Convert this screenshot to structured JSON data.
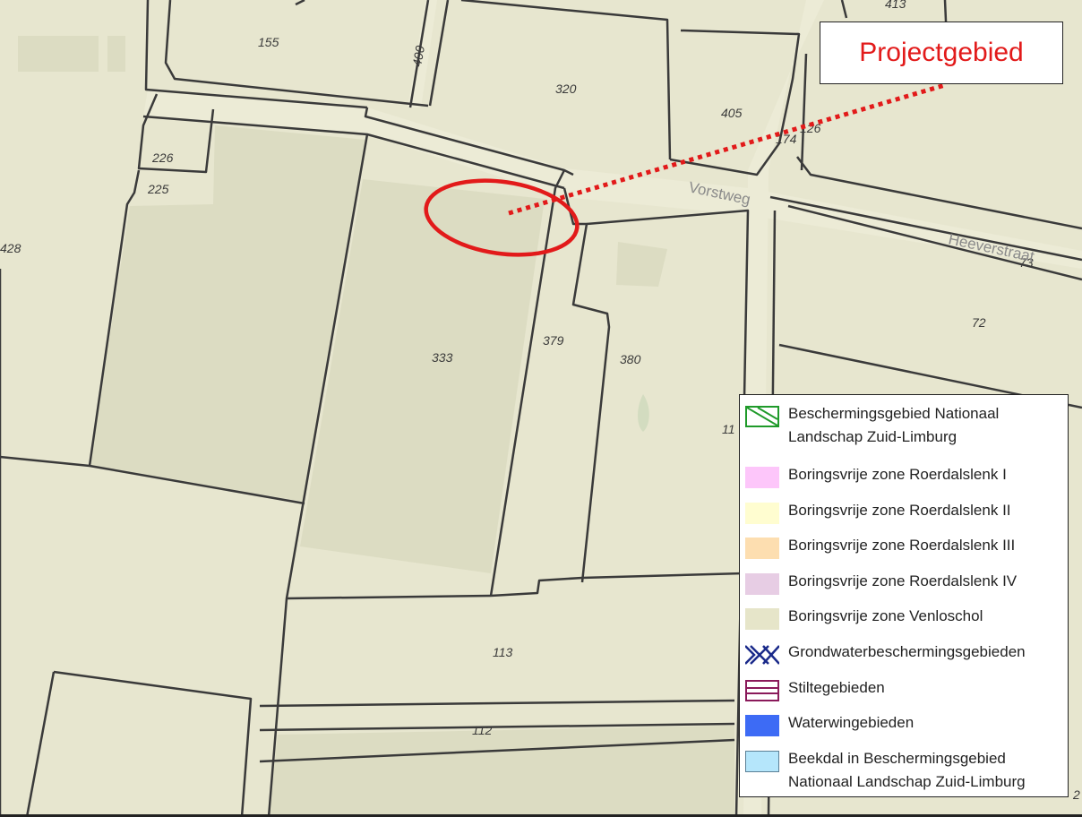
{
  "callout": {
    "label": "Projectgebied",
    "color": "#e21a1a"
  },
  "map": {
    "background_color": "#e7e6cf",
    "parcel_line_color": "#3a3a3a",
    "road_color": "#e7e6cf",
    "shaded_area_color": "#dcdcc2",
    "project_marker_color": "#e21a1a",
    "parcel_labels": [
      "413",
      "155",
      "400",
      "320",
      "405",
      "174",
      "126",
      "226",
      "225",
      "428",
      "333",
      "379",
      "380",
      "72",
      "73",
      "113",
      "112",
      "11",
      "2"
    ],
    "street_labels": [
      "Vorstweg",
      "Heeverstraat"
    ]
  },
  "legend": {
    "items": [
      {
        "label_line1": "Beschermingsgebied Nationaal",
        "label_line2": "Landschap Zuid-Limburg",
        "icon": "hatched-green-square-icon",
        "color": "#1f9a2a"
      },
      {
        "label_line1": "Boringsvrije zone Roerdalslenk I",
        "icon": "pink-swatch",
        "color": "#fdc6fa"
      },
      {
        "label_line1": "Boringsvrije zone Roerdalslenk II",
        "icon": "yellow-swatch",
        "color": "#fffdd0"
      },
      {
        "label_line1": "Boringsvrije zone Roerdalslenk III",
        "icon": "orange-swatch",
        "color": "#fddeb0"
      },
      {
        "label_line1": "Boringsvrije zone Roerdalslenk IV",
        "icon": "purple-swatch",
        "color": "#e7cde4"
      },
      {
        "label_line1": "Boringsvrije zone Venloschol",
        "icon": "beige-swatch",
        "color": "#e6e5c9"
      },
      {
        "label_line1": "Grondwaterbeschermingsgebieden",
        "icon": "blue-cross-hatch-icon",
        "color": "#1a2a8a"
      },
      {
        "label_line1": "Stiltegebieden",
        "icon": "striped-magenta-icon",
        "color": "#8a1a5b"
      },
      {
        "label_line1": "Waterwingebieden",
        "icon": "blue-swatch",
        "color": "#3d6bf5"
      },
      {
        "label_line1": "Beekdal in Beschermingsgebied",
        "label_line2": "Nationaal Landschap Zuid-Limburg",
        "icon": "light-blue-swatch",
        "color": "#b5e6fb"
      }
    ]
  }
}
